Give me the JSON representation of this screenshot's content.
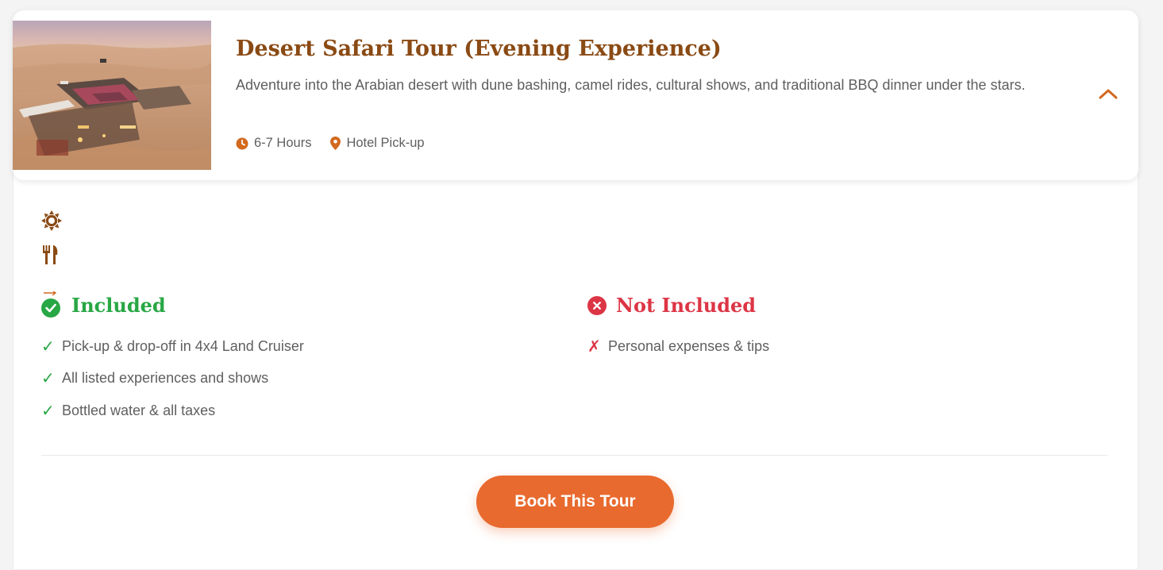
{
  "tour": {
    "title": "Desert Safari Tour (Evening Experience)",
    "description": "Adventure into the Arabian desert with dune bashing, camel rides, cultural shows, and traditional BBQ dinner under the stars.",
    "duration": "6-7 Hours",
    "pickup": "Hotel Pick-up",
    "image_alt": "desert camp at dusk"
  },
  "icons": {
    "duration": "clock-icon",
    "pickup": "map-pin-icon",
    "collapse": "chevron-up-icon",
    "feature_1": "sun-icon",
    "feature_2": "utensils-icon",
    "included": "check-circle-icon",
    "not_included": "x-circle-icon"
  },
  "included": {
    "heading": "Included",
    "items": [
      "Pick-up & drop-off in 4x4 Land Cruiser",
      "All listed experiences and shows",
      "Bottled water & all taxes"
    ]
  },
  "not_included": {
    "heading": "Not Included",
    "items": [
      "Personal expenses & tips"
    ]
  },
  "marks": {
    "check": "✓",
    "cross": "✗"
  },
  "cta": {
    "label": "Book This Tour"
  },
  "colors": {
    "brand": "#8a4a14",
    "accent": "#e86a2f",
    "success": "#28a745",
    "danger": "#dc3545"
  }
}
